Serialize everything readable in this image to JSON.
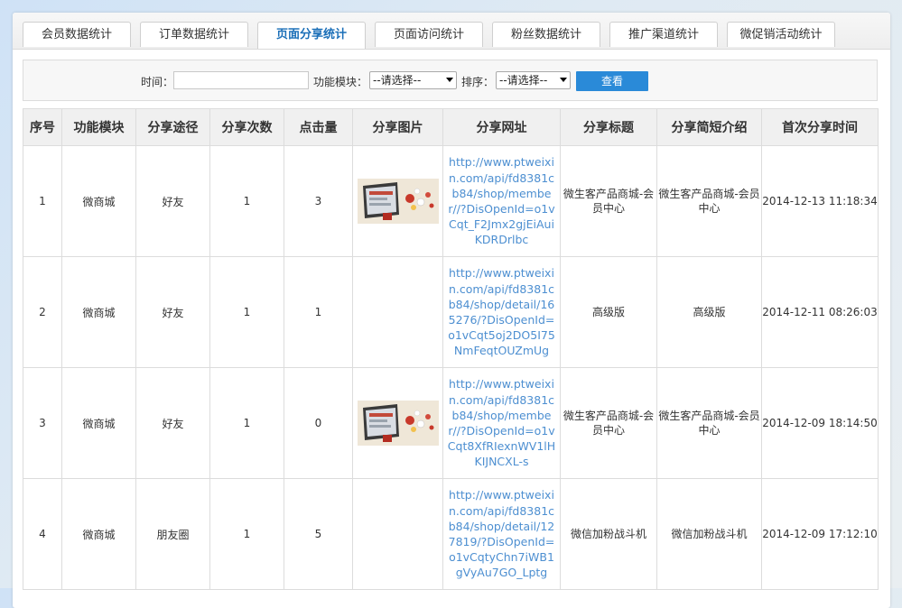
{
  "tabs": [
    {
      "label": "会员数据统计",
      "active": false
    },
    {
      "label": "订单数据统计",
      "active": false
    },
    {
      "label": "页面分享统计",
      "active": true
    },
    {
      "label": "页面访问统计",
      "active": false
    },
    {
      "label": "粉丝数据统计",
      "active": false
    },
    {
      "label": "推广渠道统计",
      "active": false
    },
    {
      "label": "微促销活动统计",
      "active": false
    }
  ],
  "filter": {
    "time_label": "时间：",
    "time_value": "",
    "module_label": "功能模块：",
    "module_selected": "--请选择--",
    "sort_label": "排序：",
    "sort_selected": "--请选择--",
    "query_button": "查看"
  },
  "table": {
    "headers": [
      "序号",
      "功能模块",
      "分享途径",
      "分享次数",
      "点击量",
      "分享图片",
      "分享网址",
      "分享标题",
      "分享简短介绍",
      "首次分享时间"
    ],
    "rows": [
      {
        "no": "1",
        "module": "微商城",
        "channel": "好友",
        "shares": "1",
        "clicks": "3",
        "has_image": true,
        "url": "http://www.ptweixin.com/api/fd8381cb84/shop/member//?DisOpenId=o1vCqt_F2Jmx2gjEiAuiKDRDrlbc",
        "title": "微生客产品商城-会员中心",
        "intro": "微生客产品商城-会员中心",
        "time": "2014-12-13 11:18:34"
      },
      {
        "no": "2",
        "module": "微商城",
        "channel": "好友",
        "shares": "1",
        "clicks": "1",
        "has_image": false,
        "url": "http://www.ptweixin.com/api/fd8381cb84/shop/detail/165276/?DisOpenId=o1vCqt5oj2DO5I75NmFeqtOUZmUg",
        "title": "高级版",
        "intro": "高级版",
        "time": "2014-12-11 08:26:03"
      },
      {
        "no": "3",
        "module": "微商城",
        "channel": "好友",
        "shares": "1",
        "clicks": "0",
        "has_image": true,
        "url": "http://www.ptweixin.com/api/fd8381cb84/shop/member//?DisOpenId=o1vCqt8XfRIexnWV1lHKIJNCXL-s",
        "title": "微生客产品商城-会员中心",
        "intro": "微生客产品商城-会员中心",
        "time": "2014-12-09 18:14:50"
      },
      {
        "no": "4",
        "module": "微商城",
        "channel": "朋友圈",
        "shares": "1",
        "clicks": "5",
        "has_image": false,
        "url": "http://www.ptweixin.com/api/fd8381cb84/shop/detail/127819/?DisOpenId=o1vCqtyChn7iWB1gVyAu7GO_Lptg",
        "title": "微信加粉战斗机",
        "intro": "微信加粉战斗机",
        "time": "2014-12-09 17:12:10"
      }
    ]
  },
  "colors": {
    "accent": "#2a8ad8",
    "link": "#4d8fd1",
    "active_tab": "#1b6fb8"
  }
}
